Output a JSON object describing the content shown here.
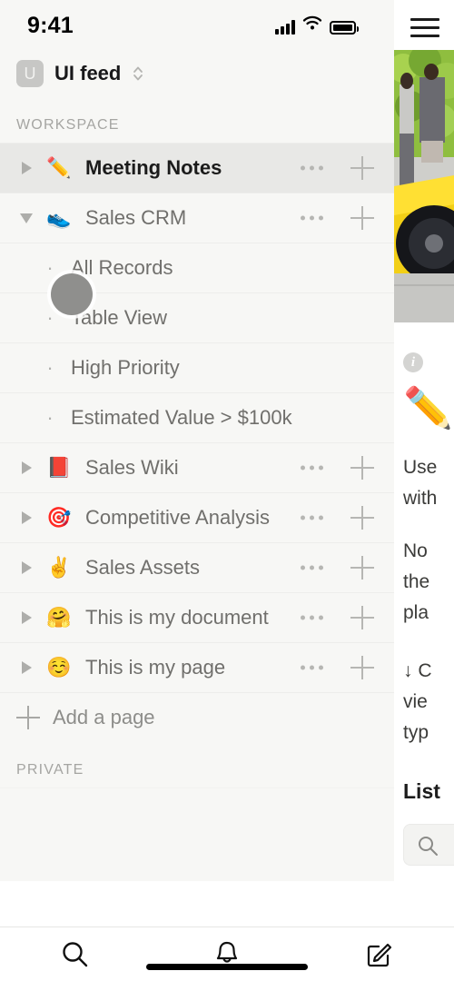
{
  "status_bar": {
    "time": "9:41",
    "signal_icon": "cellular-bars-icon",
    "wifi_icon": "wifi-icon",
    "battery_icon": "battery-full-icon"
  },
  "workspace_switcher": {
    "avatar_initial": "U",
    "name": "UI feed",
    "chevron_icon": "chevron-up-down-icon"
  },
  "sidebar": {
    "sections": [
      {
        "label": "WORKSPACE"
      },
      {
        "label": "PRIVATE"
      }
    ],
    "items": [
      {
        "emoji": "✏️",
        "emoji_name": "pencil-emoji",
        "label": "Meeting Notes",
        "twisty": "collapsed",
        "active": true
      },
      {
        "emoji": "👟",
        "emoji_name": "running-shoe-emoji",
        "label": "Sales CRM",
        "twisty": "expanded",
        "active": false
      }
    ],
    "children": [
      {
        "label": "All Records"
      },
      {
        "label": "Table View"
      },
      {
        "label": "High Priority"
      },
      {
        "label": "Estimated Value > $100k"
      }
    ],
    "items2": [
      {
        "emoji": "📕",
        "emoji_name": "closed-book-emoji",
        "label": "Sales Wiki",
        "twisty": "collapsed"
      },
      {
        "emoji": "🎯",
        "emoji_name": "direct-hit-emoji",
        "label": "Competitive Analysis",
        "twisty": "collapsed"
      },
      {
        "emoji": "✌️",
        "emoji_name": "victory-hand-emoji",
        "label": "Sales Assets",
        "twisty": "collapsed"
      },
      {
        "emoji": "🤗",
        "emoji_name": "hugging-face-emoji",
        "label": "This is my document",
        "twisty": "collapsed"
      },
      {
        "emoji": "☺️",
        "emoji_name": "relaxed-face-emoji",
        "label": "This is my page",
        "twisty": "collapsed"
      }
    ],
    "add_page_label": "Add a page",
    "row_more_icon": "ellipsis-icon",
    "row_add_icon": "plus-icon",
    "child_bullet": "·"
  },
  "page_panel": {
    "menu_icon": "hamburger-menu-icon",
    "cover_image_name": "cover-photo-yellow-sports-car",
    "info_icon": "info-icon",
    "page_emoji": "✏️",
    "page_emoji_name": "pencil-emoji",
    "paragraph_1": "Use",
    "paragraph_1b": "with",
    "paragraph_2": "No",
    "paragraph_2b": "the",
    "paragraph_2c": "pla",
    "paragraph_3": "↓ C",
    "paragraph_3b": "vie",
    "paragraph_3c": "typ",
    "heading": "List",
    "search_icon": "search-icon",
    "document_icon": "page-icon"
  },
  "tab_bar": {
    "tabs": [
      {
        "icon": "search-icon",
        "name": "tab-search"
      },
      {
        "icon": "bell-icon",
        "name": "tab-notifications"
      },
      {
        "icon": "compose-icon",
        "name": "tab-compose"
      }
    ],
    "home_indicator": "home-indicator"
  },
  "colors": {
    "sidebar_bg": "#f7f7f5",
    "active_row_bg": "#e8e8e6",
    "text_primary": "#1b1b1b",
    "text_secondary": "#706f6c",
    "text_muted": "#a5a5a2",
    "divider": "#ededeb",
    "touch_indicator": "#8f8f8d"
  }
}
